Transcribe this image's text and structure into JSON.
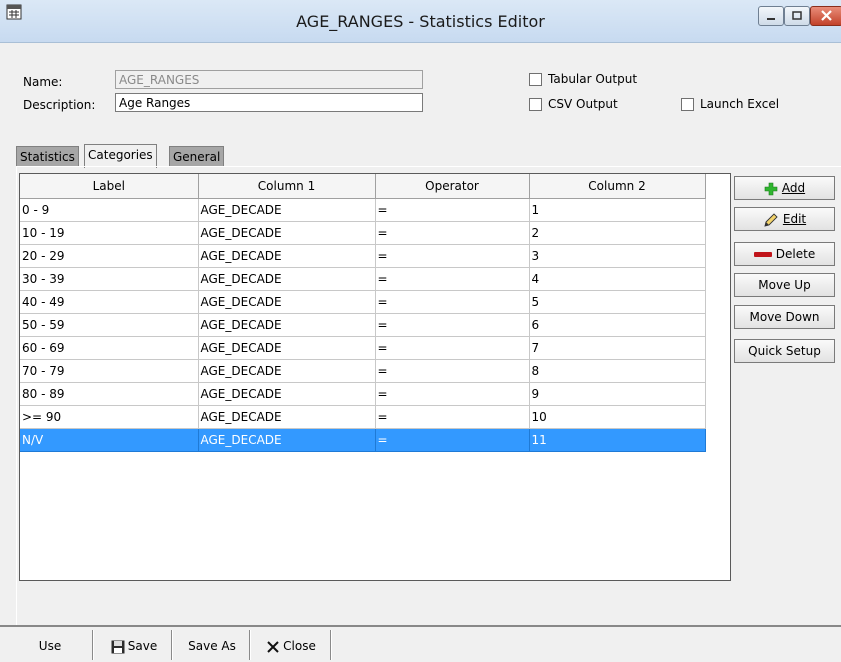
{
  "window": {
    "title": "AGE_RANGES - Statistics Editor",
    "icons": {
      "app": "calendar-app-icon",
      "minimize": "minimize-icon",
      "maximize": "maximize-icon",
      "close": "close-icon"
    }
  },
  "form": {
    "name_label": "Name:",
    "name_value": "AGE_RANGES",
    "description_label": "Description:",
    "description_value": "Age Ranges",
    "tabular_output_label": "Tabular Output",
    "tabular_output_checked": false,
    "csv_output_label": "CSV Output",
    "csv_output_checked": false,
    "launch_excel_label": "Launch Excel",
    "launch_excel_checked": false
  },
  "tabs": [
    {
      "label": "Statistics",
      "active": false
    },
    {
      "label": "Categories",
      "active": true
    },
    {
      "label": "General",
      "active": false
    }
  ],
  "grid": {
    "columns": [
      "Label",
      "Column 1",
      "Operator",
      "Column 2"
    ],
    "rows": [
      [
        "0 - 9",
        "AGE_DECADE",
        "=",
        "1"
      ],
      [
        "10 - 19",
        "AGE_DECADE",
        "=",
        "2"
      ],
      [
        "20 - 29",
        "AGE_DECADE",
        "=",
        "3"
      ],
      [
        "30 - 39",
        "AGE_DECADE",
        "=",
        "4"
      ],
      [
        "40 - 49",
        "AGE_DECADE",
        "=",
        "5"
      ],
      [
        "50 - 59",
        "AGE_DECADE",
        "=",
        "6"
      ],
      [
        "60 - 69",
        "AGE_DECADE",
        "=",
        "7"
      ],
      [
        "70 - 79",
        "AGE_DECADE",
        "=",
        "8"
      ],
      [
        "80 - 89",
        "AGE_DECADE",
        "=",
        "9"
      ],
      [
        ">= 90",
        "AGE_DECADE",
        "=",
        "10"
      ],
      [
        "N/V",
        "AGE_DECADE",
        "=",
        "11"
      ]
    ],
    "selected_row": 10
  },
  "side_buttons": {
    "add": {
      "label": "Add",
      "accel": "A",
      "icon": "plus-icon",
      "color": "#2fb52f"
    },
    "edit": {
      "label": "Edit",
      "accel": "E",
      "icon": "pencil-icon"
    },
    "delete": {
      "label": "Delete",
      "accel": "D",
      "icon": "minus-icon",
      "color": "#c0141a"
    },
    "move_up": {
      "label": "Move Up",
      "accel": "U"
    },
    "move_down": {
      "label": "Move Down",
      "accel": "D"
    },
    "quick_setup": {
      "label": "Quick Setup",
      "accel": "Q"
    }
  },
  "bottom_buttons": {
    "use": {
      "label": "Use",
      "accel": "U"
    },
    "save": {
      "label": "Save",
      "accel": "S",
      "icon": "floppy-disk-icon"
    },
    "save_as": {
      "label": "Save As",
      "accel": "A"
    },
    "close": {
      "label": "Close",
      "accel": "C",
      "icon": "x-icon"
    }
  },
  "colors": {
    "selection": "#3399ff",
    "inactive_tab": "#a6a6a6"
  }
}
